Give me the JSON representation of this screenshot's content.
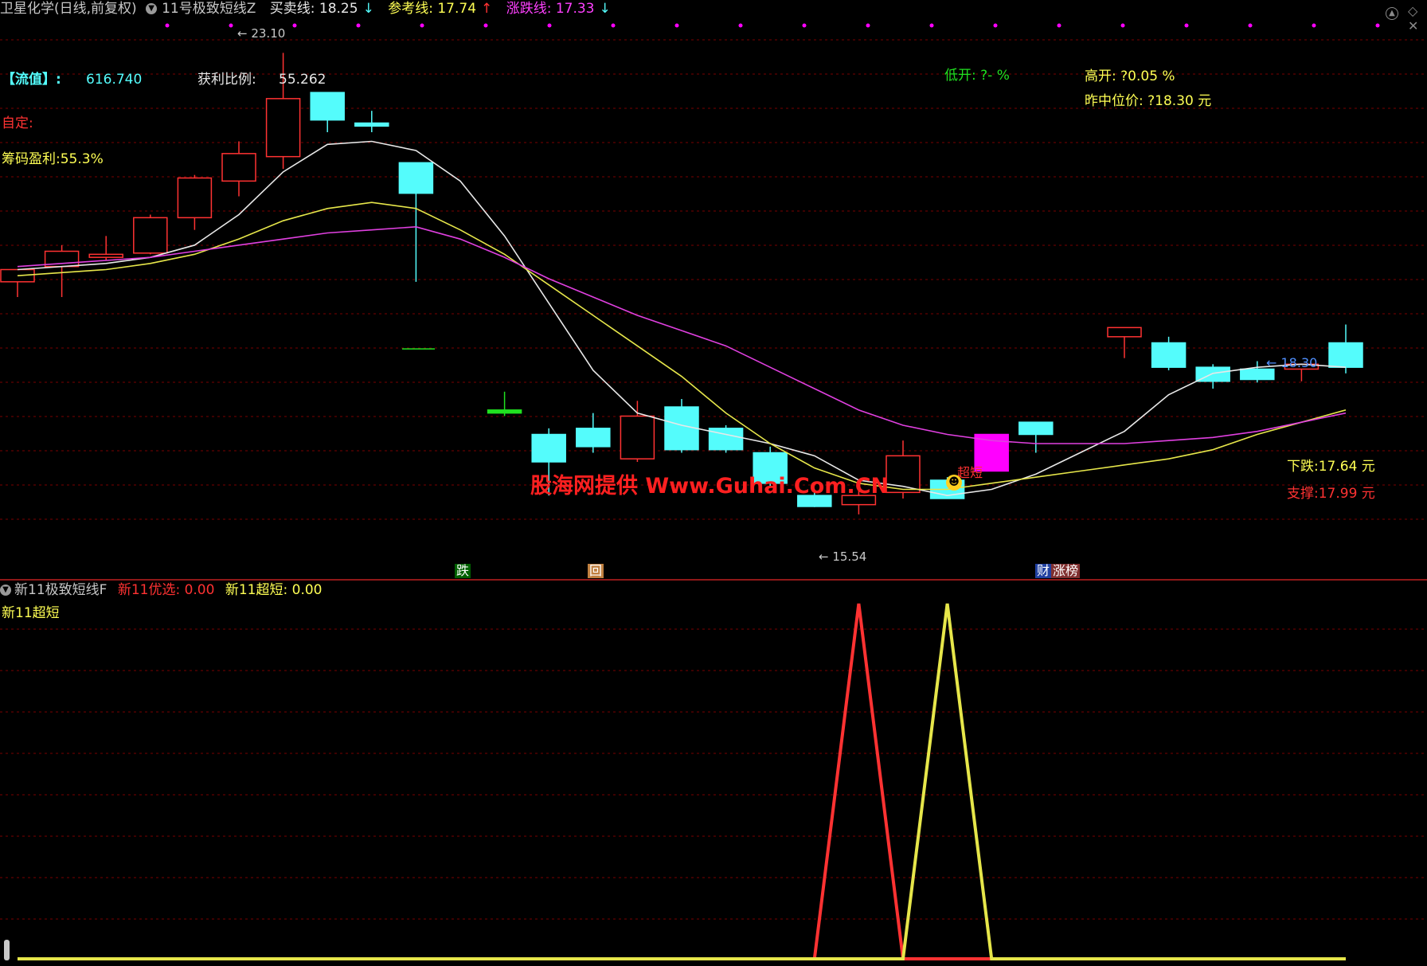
{
  "header": {
    "stock_name": "卫星化学(日线,前复权)",
    "indicator_name": "11号极致短线Z",
    "buy_sell_line": "买卖线: 18.25",
    "buy_sell_arrow": "↓",
    "reference_line": "参考线: 17.74",
    "reference_arrow": "↑",
    "rise_fall_line": "涨跌线: 17.33",
    "rise_fall_arrow": "↓"
  },
  "annotations": {
    "market_value_label": "【流值】:",
    "market_value": "616.740",
    "profit_ratio_label": "获利比例:",
    "profit_ratio": "55.262",
    "custom_label": "自定:",
    "chip_profit": "筹码盈利:55.3%",
    "low_open": "低开: ?- %",
    "high_open": "高开: ?0.05 %",
    "yesterday_mid": "昨中位价: ?18.30 元",
    "high_price": "← 23.10",
    "low_price": "← 15.54",
    "last_price": "← 18.30",
    "fall_price": "下跌:17.64 元",
    "support_price": "支撑:17.99 元",
    "super_short_tag": "超短",
    "watermark": "股海网提供 Www.Guhai.Com.CN",
    "badge_fall": "跌",
    "badge_back": "回",
    "badge_cai": "财",
    "badge_zhangbang": "涨榜"
  },
  "sub_header": {
    "indicator_name": "新11极致短线F",
    "preferred": "新11优选: 0.00",
    "super_short": "新11超短: 0.00",
    "legend": "新11超短"
  },
  "colors": {
    "up": "#ff3232",
    "down": "#54fcfc",
    "ma_white": "#e8e8e8",
    "ma_yellow": "#e6e64a",
    "ma_magenta": "#e040e0",
    "grid": "#7a0000",
    "yellow_text": "#ffff54",
    "magenta_special": "#ff00ff",
    "green_special": "#20e020"
  },
  "chart_data": [
    {
      "type": "candlestick",
      "title": "卫星化学(日线,前复权)",
      "ylim": [
        14.9,
        23.6
      ],
      "candles": [
        {
          "o": 19.35,
          "h": 19.55,
          "l": 19.1,
          "c": 19.55,
          "color": "up"
        },
        {
          "o": 19.6,
          "h": 19.95,
          "l": 19.1,
          "c": 19.85,
          "color": "up"
        },
        {
          "o": 19.75,
          "h": 20.1,
          "l": 19.7,
          "c": 19.8,
          "color": "up"
        },
        {
          "o": 19.82,
          "h": 20.45,
          "l": 19.8,
          "c": 20.4,
          "color": "up"
        },
        {
          "o": 20.4,
          "h": 21.1,
          "l": 20.2,
          "c": 21.05,
          "color": "up"
        },
        {
          "o": 21.0,
          "h": 21.65,
          "l": 20.75,
          "c": 21.45,
          "color": "up"
        },
        {
          "o": 21.4,
          "h": 23.1,
          "l": 21.2,
          "c": 22.35,
          "color": "up"
        },
        {
          "o": 22.45,
          "h": 22.45,
          "l": 21.8,
          "c": 22.0,
          "color": "down"
        },
        {
          "o": 21.95,
          "h": 22.15,
          "l": 21.8,
          "c": 21.9,
          "color": "down"
        },
        {
          "o": 21.3,
          "h": 21.3,
          "l": 19.35,
          "c": 20.8,
          "color": "down"
        },
        {
          "o": null,
          "h": null,
          "l": null,
          "c": null,
          "color": "gap"
        },
        {
          "o": 17.2,
          "h": 17.55,
          "l": 17.15,
          "c": 17.25,
          "color": "special-green"
        },
        {
          "o": 16.85,
          "h": 16.95,
          "l": 15.85,
          "c": 16.4,
          "color": "down"
        },
        {
          "o": 16.95,
          "h": 17.2,
          "l": 16.55,
          "c": 16.65,
          "color": "down"
        },
        {
          "o": 16.45,
          "h": 17.4,
          "l": 16.4,
          "c": 17.15,
          "color": "up"
        },
        {
          "o": 17.3,
          "h": 17.43,
          "l": 16.55,
          "c": 16.6,
          "color": "down"
        },
        {
          "o": 16.95,
          "h": 17.0,
          "l": 16.55,
          "c": 16.6,
          "color": "down"
        },
        {
          "o": 16.55,
          "h": 16.65,
          "l": 16.0,
          "c": 16.05,
          "color": "down"
        },
        {
          "o": 15.85,
          "h": 15.95,
          "l": 15.66,
          "c": 15.67,
          "color": "down"
        },
        {
          "o": 15.7,
          "h": 15.95,
          "l": 15.54,
          "c": 15.85,
          "color": "up"
        },
        {
          "o": 15.9,
          "h": 16.75,
          "l": 15.8,
          "c": 16.5,
          "color": "up"
        },
        {
          "o": 16.1,
          "h": 16.15,
          "l": 15.8,
          "c": 15.8,
          "color": "down"
        },
        {
          "o": 16.85,
          "h": 16.85,
          "l": 16.25,
          "c": 16.25,
          "color": "special-magenta"
        },
        {
          "o": 17.05,
          "h": 17.05,
          "l": 16.55,
          "c": 16.85,
          "color": "down"
        },
        {
          "o": null,
          "h": null,
          "l": null,
          "c": null,
          "color": "gap"
        },
        {
          "o": 18.6,
          "h": 18.6,
          "l": 18.1,
          "c": 18.45,
          "color": "up"
        },
        {
          "o": 18.35,
          "h": 18.45,
          "l": 17.9,
          "c": 17.95,
          "color": "down"
        },
        {
          "o": 17.95,
          "h": 18.0,
          "l": 17.6,
          "c": 17.72,
          "color": "down"
        },
        {
          "o": 17.92,
          "h": 18.05,
          "l": 17.7,
          "c": 17.75,
          "color": "down"
        },
        {
          "o": 17.92,
          "h": 18.0,
          "l": 17.72,
          "c": 18.0,
          "color": "up"
        },
        {
          "o": 18.35,
          "h": 18.65,
          "l": 17.85,
          "c": 17.95,
          "color": "down"
        }
      ],
      "series": [
        {
          "name": "",
          "color": "ma_white",
          "values": [
            19.55,
            19.6,
            19.65,
            19.75,
            19.95,
            20.45,
            21.15,
            21.6,
            21.65,
            21.5,
            21.0,
            20.1,
            19.0,
            17.9,
            17.2,
            17.0,
            16.85,
            16.7,
            16.5,
            16.1,
            16.0,
            15.85,
            15.95,
            16.2,
            16.55,
            16.9,
            17.5,
            17.85,
            17.95,
            18.0,
            17.95
          ]
        },
        {
          "name": "",
          "color": "ma_yellow",
          "values": [
            19.45,
            19.5,
            19.55,
            19.65,
            19.8,
            20.05,
            20.35,
            20.55,
            20.65,
            20.55,
            20.2,
            19.8,
            19.3,
            18.8,
            18.3,
            17.8,
            17.2,
            16.7,
            16.3,
            16.05,
            15.95,
            15.95,
            16.05,
            16.15,
            16.25,
            16.35,
            16.45,
            16.6,
            16.85,
            17.05,
            17.25
          ]
        },
        {
          "name": "",
          "color": "ma_magenta",
          "values": [
            19.6,
            19.65,
            19.7,
            19.75,
            19.85,
            19.95,
            20.05,
            20.15,
            20.2,
            20.25,
            20.05,
            19.75,
            19.4,
            19.1,
            18.8,
            18.55,
            18.3,
            17.95,
            17.6,
            17.25,
            17.0,
            16.85,
            16.75,
            16.7,
            16.7,
            16.7,
            16.75,
            16.8,
            16.9,
            17.05,
            17.2
          ]
        }
      ],
      "reference_lines": [
        {
          "name": "",
          "value": 18.25,
          "dashed": true
        }
      ]
    },
    {
      "type": "line",
      "title": "新11极致短线F",
      "ylim": [
        0,
        1
      ],
      "series": [
        {
          "name": "新11优选",
          "color": "up",
          "values": [
            0,
            0,
            0,
            0,
            0,
            0,
            0,
            0,
            0,
            0,
            0,
            0,
            0,
            0,
            0,
            0,
            0,
            0,
            0,
            1,
            0,
            0,
            0,
            0,
            0,
            0,
            0,
            0,
            0,
            0,
            0
          ]
        },
        {
          "name": "新11超短",
          "color": "ma_yellow",
          "values": [
            0,
            0,
            0,
            0,
            0,
            0,
            0,
            0,
            0,
            0,
            0,
            0,
            0,
            0,
            0,
            0,
            0,
            0,
            0,
            0,
            0,
            1,
            0,
            0,
            0,
            0,
            0,
            0,
            0,
            0,
            0
          ]
        }
      ]
    }
  ]
}
